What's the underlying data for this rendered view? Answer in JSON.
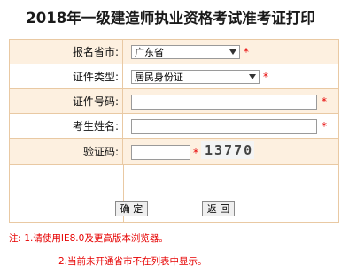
{
  "title": "2018年一级建造师执业资格考试准考证打印",
  "form": {
    "province": {
      "label": "报名省市:",
      "value": "广东省"
    },
    "id_type": {
      "label": "证件类型:",
      "value": "居民身份证"
    },
    "id_number": {
      "label": "证件号码:",
      "value": ""
    },
    "name": {
      "label": "考生姓名:",
      "value": ""
    },
    "captcha": {
      "label": "验证码:",
      "value": "",
      "image_text": "13770"
    },
    "required_mark": "*"
  },
  "buttons": {
    "confirm": "确 定",
    "back": "返 回"
  },
  "notes": {
    "line1": "注: 1.请使用IE8.0及更高版本浏览器。",
    "line2": "2.当前未开通省市不在列表中显示。"
  },
  "colors": {
    "required": "#e60000",
    "row_alt_bg": "#fdf0e0",
    "border": "#e9c9a3"
  }
}
